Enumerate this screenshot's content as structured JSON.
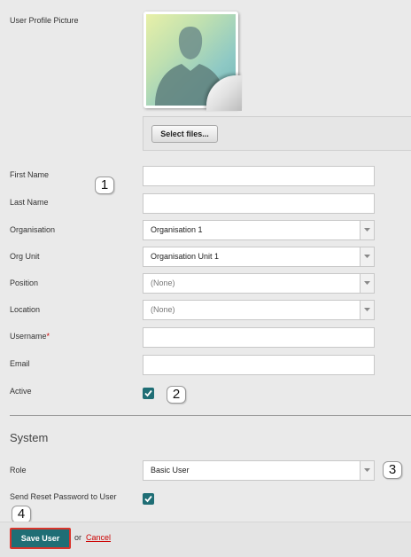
{
  "profile": {
    "picture_label": "User Profile Picture",
    "select_files_label": "Select files..."
  },
  "fields": {
    "first_name_label": "First Name",
    "first_name_value": "",
    "last_name_label": "Last Name",
    "last_name_value": "",
    "organisation_label": "Organisation",
    "organisation_value": "Organisation 1",
    "org_unit_label": "Org Unit",
    "org_unit_value": "Organisation Unit 1",
    "position_label": "Position",
    "position_value": "(None)",
    "location_label": "Location",
    "location_value": "(None)",
    "username_label": "Username",
    "username_required_mark": "*",
    "username_value": "",
    "email_label": "Email",
    "email_value": "",
    "active_label": "Active",
    "active_checked": true
  },
  "system": {
    "title": "System",
    "role_label": "Role",
    "role_value": "Basic User",
    "reset_password_label": "Send Reset Password to User",
    "reset_password_checked": true
  },
  "actions": {
    "save_label": "Save User",
    "or_text": "or",
    "cancel_label": "Cancel"
  },
  "callouts": [
    "1",
    "2",
    "3",
    "4"
  ],
  "colors": {
    "accent": "#1f6e75",
    "save_border": "#d9342b",
    "cancel_link": "#cc0000",
    "required": "#cc0000"
  }
}
